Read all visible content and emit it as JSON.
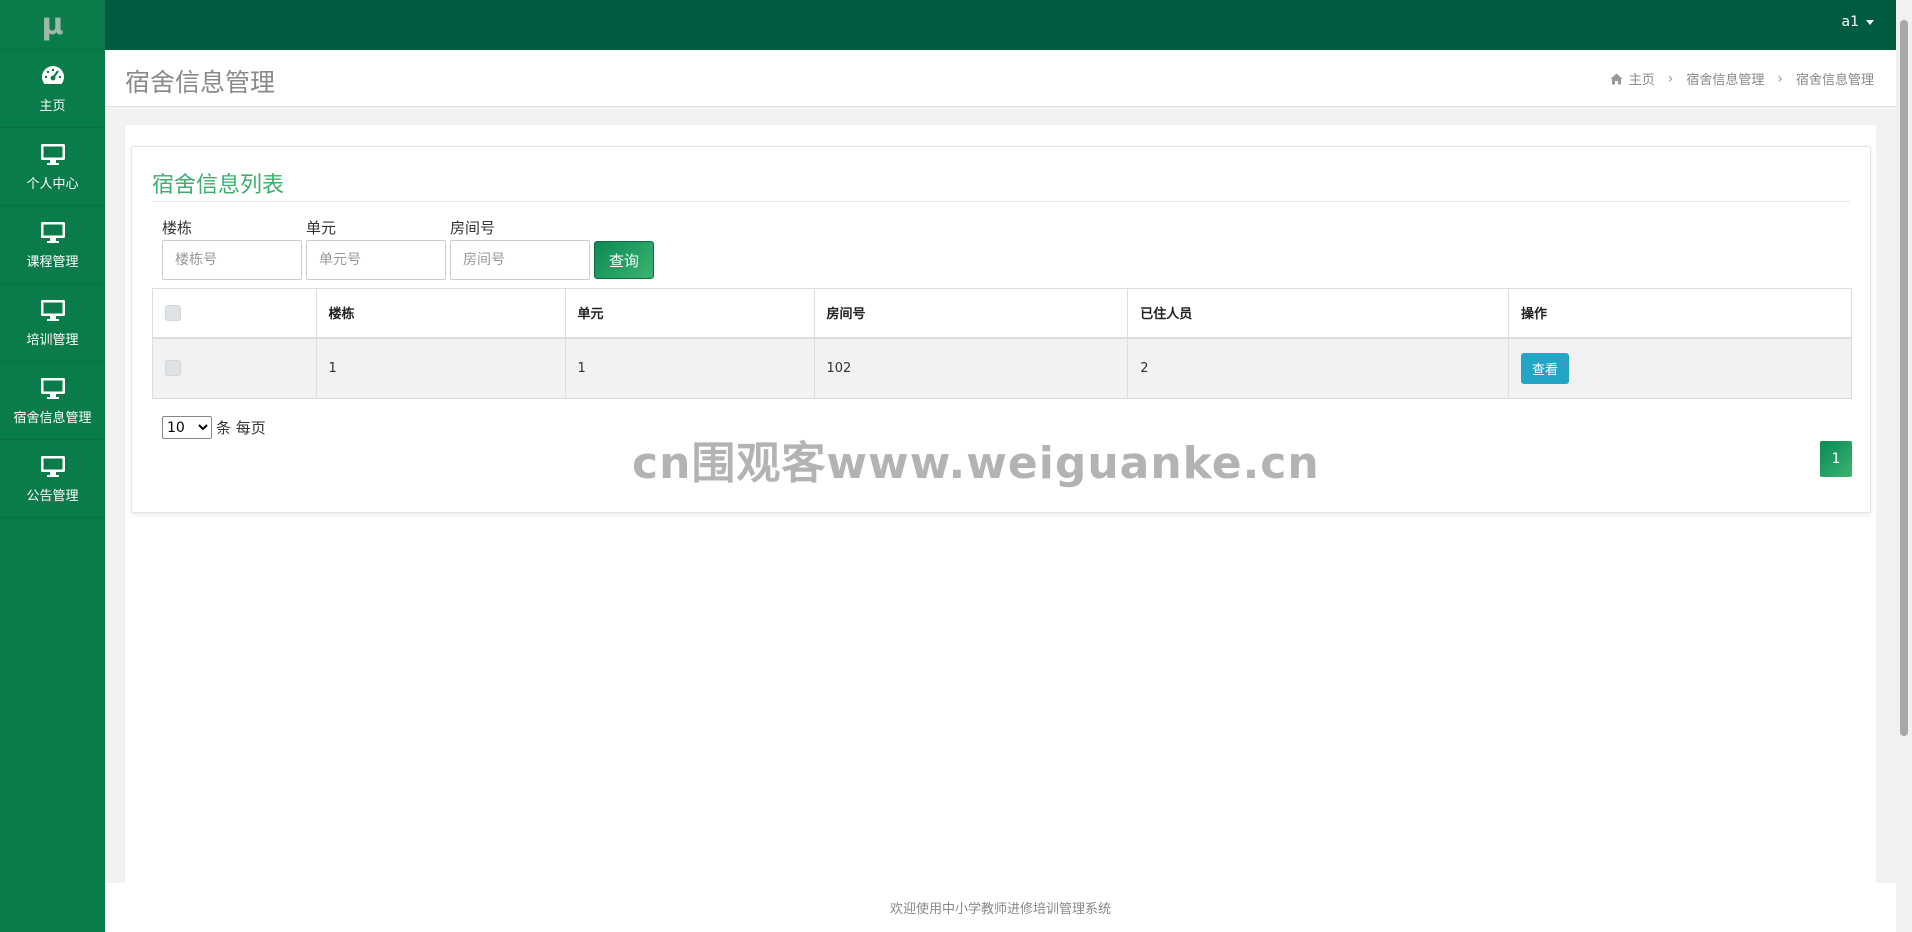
{
  "brand": {
    "logo_text": "μ"
  },
  "sidebar": {
    "items": [
      {
        "label": "主页",
        "icon": "dashboard-icon"
      },
      {
        "label": "个人中心",
        "icon": "monitor-icon"
      },
      {
        "label": "课程管理",
        "icon": "monitor-icon"
      },
      {
        "label": "培训管理",
        "icon": "monitor-icon"
      },
      {
        "label": "宿舍信息管理",
        "icon": "monitor-icon"
      },
      {
        "label": "公告管理",
        "icon": "monitor-icon"
      }
    ]
  },
  "topbar": {
    "user": "a1"
  },
  "header": {
    "title": "宿舍信息管理",
    "breadcrumb": [
      "主页",
      "宿舍信息管理",
      "宿舍信息管理"
    ]
  },
  "panel": {
    "title": "宿舍信息列表",
    "search": {
      "fields": [
        {
          "label": "楼栋",
          "placeholder": "楼栋号",
          "value": ""
        },
        {
          "label": "单元",
          "placeholder": "单元号",
          "value": ""
        },
        {
          "label": "房间号",
          "placeholder": "房间号",
          "value": ""
        }
      ],
      "query_label": "查询"
    },
    "table": {
      "columns": [
        "楼栋",
        "单元",
        "房间号",
        "已住人员",
        "操作"
      ],
      "rows": [
        {
          "building": "1",
          "unit": "1",
          "room": "102",
          "residents": "2",
          "action": "查看"
        }
      ]
    },
    "pagination": {
      "page_size": "10",
      "page_size_suffix": "条 每页",
      "current_page": "1"
    }
  },
  "watermark": "cn围观客www.weiguanke.cn",
  "footer": {
    "text": "欢迎使用中小学教师进修培训管理系统"
  },
  "colors": {
    "sidebar_bg": "#0a7c4a",
    "topbar_bg": "#005c40",
    "accent": "#3fae6d",
    "view_button": "#23a6c5"
  }
}
